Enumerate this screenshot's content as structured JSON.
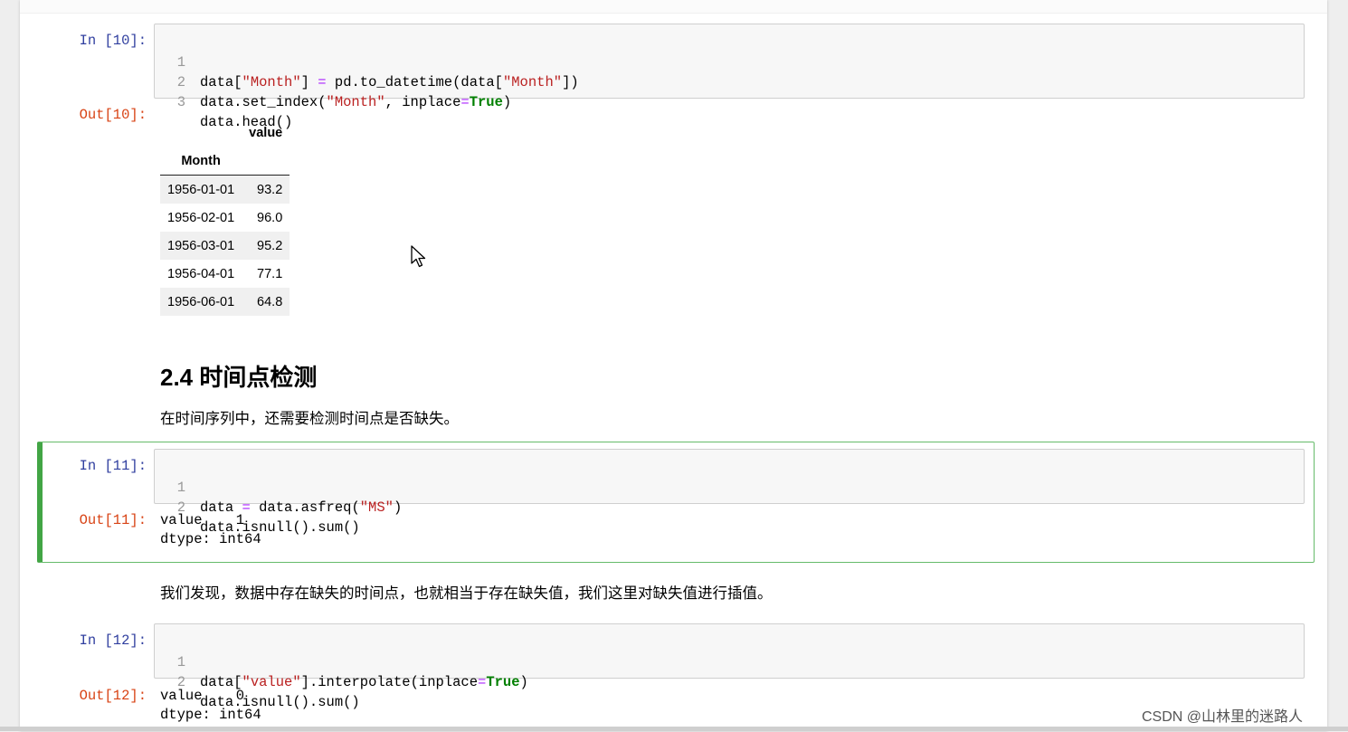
{
  "cells": {
    "c10": {
      "in_prompt": "In  [10]:",
      "out_prompt": "Out[10]:",
      "line_numbers": [
        "1",
        "2",
        "3"
      ]
    },
    "c11": {
      "in_prompt": "In  [11]:",
      "out_prompt": "Out[11]:",
      "line_numbers": [
        "1",
        "2"
      ],
      "output_lines": [
        "value    1",
        "dtype: int64"
      ]
    },
    "c12": {
      "in_prompt": "In  [12]:",
      "out_prompt": "Out[12]:",
      "line_numbers": [
        "1",
        "2"
      ],
      "output_lines": [
        "value    0",
        "dtype: int64"
      ]
    }
  },
  "code_tokens": {
    "data": "data",
    "month_str": "\"Month\"",
    "value_str": "\"value\"",
    "ms_str": "\"MS\"",
    "to_datetime": "pd.to_datetime(",
    "set_index": "data.set_index(",
    "inplace": ", inplace",
    "inplace_arg": "inplace",
    "true_kw": "True",
    "head": "data.head()",
    "asfreq": "data.asfreq(",
    "isnull_sum": "data.isnull().sum()",
    "interpolate": "].interpolate(",
    "assign_eq": " = ",
    "eq": "="
  },
  "dataframe": {
    "column_header": "value",
    "index_name": "Month",
    "rows": [
      {
        "index": "1956-01-01",
        "value": "93.2"
      },
      {
        "index": "1956-02-01",
        "value": "96.0"
      },
      {
        "index": "1956-03-01",
        "value": "95.2"
      },
      {
        "index": "1956-04-01",
        "value": "77.1"
      },
      {
        "index": "1956-06-01",
        "value": "64.8"
      }
    ]
  },
  "section": {
    "heading": "2.4  时间点检测",
    "intro": "在时间序列中，还需要检测时间点是否缺失。",
    "finding": "我们发现，数据中存在缺失的时间点，也就相当于存在缺失值，我们这里对缺失值进行插值。"
  },
  "watermark": "CSDN @山林里的迷路人",
  "colors": {
    "prompt_in": "#303f9f",
    "prompt_out": "#d84315",
    "string": "#ba2121",
    "keyword": "#008000",
    "selected_border": "#42a545"
  }
}
